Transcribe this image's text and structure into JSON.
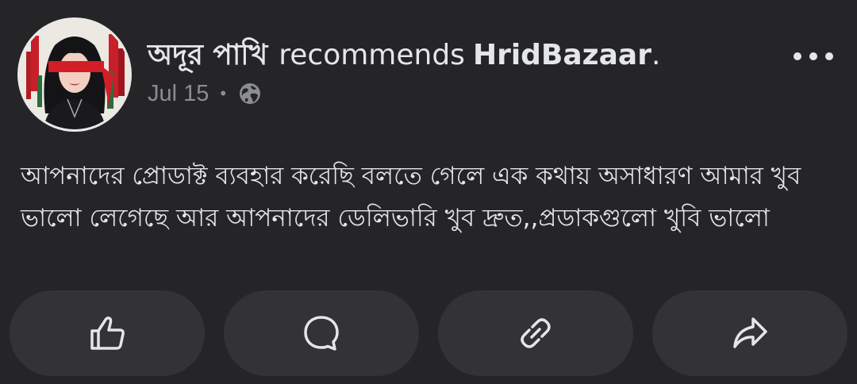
{
  "post": {
    "author": "অদূর পাখি",
    "verb": "recommends",
    "page": "HridBazaar",
    "page_suffix": ".",
    "date": "Jul 15",
    "separator": "•",
    "privacy_icon": "globe-icon",
    "text": "আপনাদের প্রোডাক্ট ব্যবহার করেছি বলতে গেলে এক কথায় অসাধারণ আমার খুব ভালো লেগেছে আর আপনাদের ডেলিভারি খুব দ্রুত,,প্রডাকগুলো খুবি ভালো"
  },
  "actions": [
    {
      "icon": "thumbs-up-icon"
    },
    {
      "icon": "comment-icon"
    },
    {
      "icon": "link-icon"
    },
    {
      "icon": "share-icon"
    }
  ],
  "colors": {
    "background": "#252527",
    "button_background": "#333335",
    "primary_text": "#e4e6eb",
    "secondary_text": "#8a8d91",
    "avatar_blindfold": "#d21e26"
  }
}
